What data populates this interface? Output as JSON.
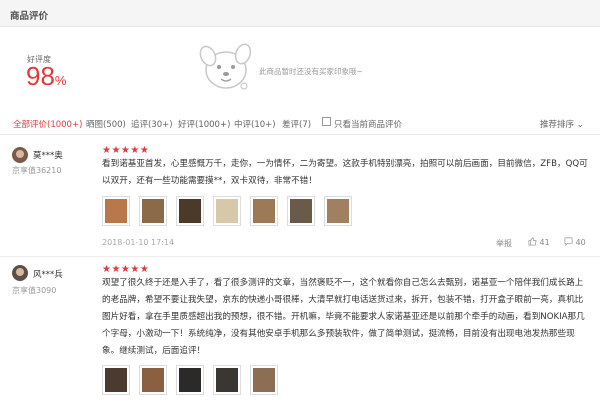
{
  "header": {
    "title": "商品评价"
  },
  "summary": {
    "rate_label": "好评度",
    "rate_number": "98",
    "rate_unit": "%",
    "no_impression": "此商品暂时还没有买家印象哦~"
  },
  "filters": {
    "tabs": [
      {
        "label": "全部评价(1000+)",
        "active": true
      },
      {
        "label": "晒图(500)"
      },
      {
        "label": "追评(30+)"
      },
      {
        "label": "好评(1000+)"
      },
      {
        "label": "中评(10+)"
      },
      {
        "label": "差评(7)"
      }
    ],
    "only_current_label": "只看当前商品评价",
    "sort_label": "推荐排序",
    "sort_caret": "⌄"
  },
  "reviews": [
    {
      "username": "莫***奥",
      "level": "京享值36210",
      "stars": "★★★★★",
      "text": "看到诺基亚首发，心里感慨万千，走你，一为情怀，二为寄望。这款手机特别漂亮，拍照可以前后画面，目前微信，ZFB，QQ可以双开，还有一些功能需要摸**，双卡双待，非常不错！",
      "thumbs": [
        "#b9784a",
        "#8a6a48",
        "#4b3a2a",
        "#d6c8a8",
        "#9c7a55",
        "#6a5a4a",
        "#a08060"
      ],
      "date": "2018-01-10 17:14",
      "report": "举报",
      "likes": "41",
      "replies": "40"
    },
    {
      "username": "风***兵",
      "level": "京享值3090",
      "stars": "★★★★★",
      "text": "观望了很久终于还是入手了，看了很多测评的文章，当然褒贬不一，这个就看你自己怎么去甄别，诺基亚一个陪伴我们成长路上的老品牌，希望不要让我失望，京东的快递小哥很棒，大清早就打电话送货过来，拆开，包装不错，打开盒子眼前一亮，真机比图片好看，拿在手里质感超出我的预想，很不错。开机嘛，毕竟不能要求人家诺基亚还是以前那个牵手的动画，看到NOKIA那几个字母，小激动一下！系统纯净，没有其他安卓手机那么多预装软件，做了简单测试，挺流畅，目前没有出现电池发热那些现象。继续测试，后面追评！",
      "thumbs": [
        "#4a3a30",
        "#8a6040",
        "#2c2a28",
        "#3a3632",
        "#8c6e54"
      ]
    }
  ]
}
